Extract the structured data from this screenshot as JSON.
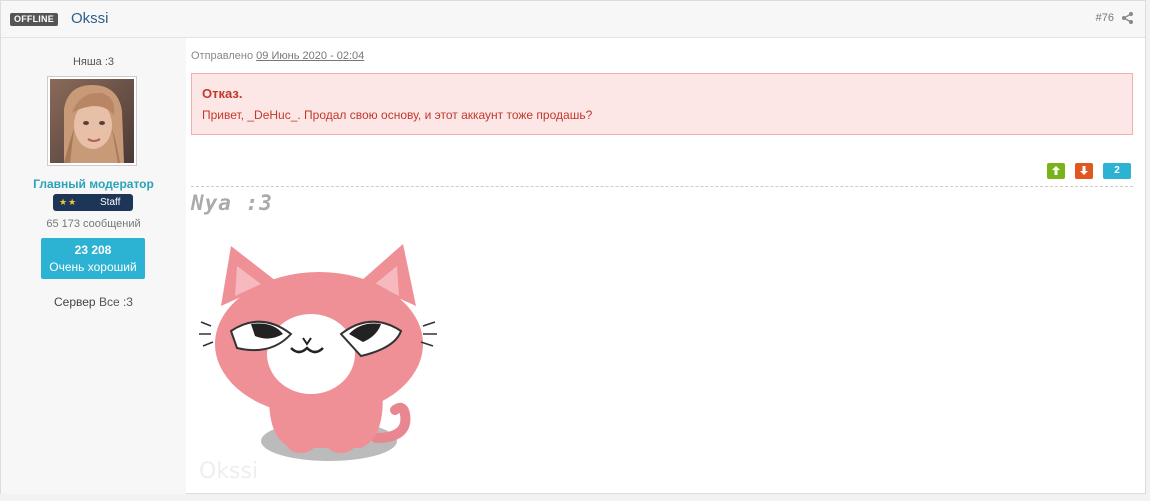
{
  "post": {
    "status": "OFFLINE",
    "author": "Okssi",
    "number": "#76",
    "date_prefix": "Отправлено",
    "date": "09 Июнь 2020 - 02:04"
  },
  "author_info": {
    "title": "Няша :3",
    "group": "Главный модератор",
    "badge_stars": "★★",
    "badge_label": "Staff",
    "post_count": "65 173 сообщений",
    "reputation_value": "23 208",
    "reputation_label": "Очень хороший",
    "server_label": "Сервер",
    "server_value": "Все :3"
  },
  "moderation": {
    "title": "Отказ.",
    "text": "Привет, _DeHuc_. Продал свою основу, и этот аккаунт тоже продашь?"
  },
  "votes": {
    "count": "2"
  },
  "signature": {
    "text": "Nya :3",
    "watermark": "Okssi"
  },
  "colors": {
    "accent": "#2cb3d4",
    "vote_up": "#7ab317",
    "vote_down": "#e0571f",
    "moderation_bg": "#fde6e6",
    "moderation_text": "#c0392b"
  }
}
